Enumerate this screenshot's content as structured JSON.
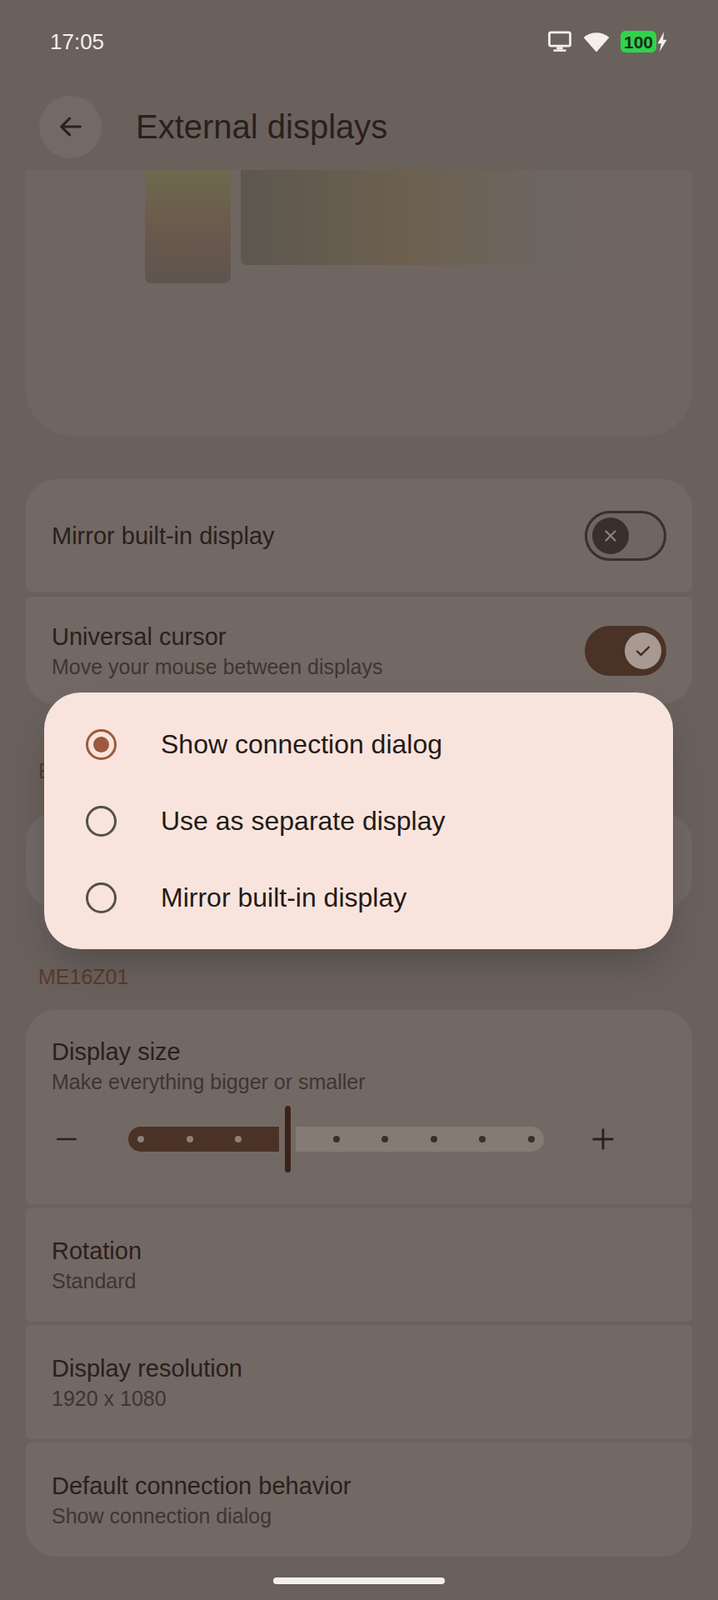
{
  "status_bar": {
    "time": "17:05",
    "battery": "100",
    "charging": true
  },
  "header": {
    "title": "External displays"
  },
  "toggles": [
    {
      "label": "Mirror built-in display",
      "on": false
    },
    {
      "label": "Universal cursor",
      "subtitle": "Move your mouse between displays",
      "on": true
    }
  ],
  "section_header": "E",
  "display_name": "ME16Z01",
  "display_size": {
    "title": "Display size",
    "subtitle": "Make everything bigger or smaller",
    "level": 0.375,
    "ticks": 9
  },
  "settings": [
    {
      "title": "Rotation",
      "value": "Standard"
    },
    {
      "title": "Display resolution",
      "value": "1920 x 1080"
    },
    {
      "title": "Default connection behavior",
      "value": "Show connection dialog"
    }
  ],
  "dialog": {
    "options": [
      {
        "label": "Show connection dialog",
        "selected": true
      },
      {
        "label": "Use as separate display",
        "selected": false
      },
      {
        "label": "Mirror built-in display",
        "selected": false
      }
    ]
  }
}
